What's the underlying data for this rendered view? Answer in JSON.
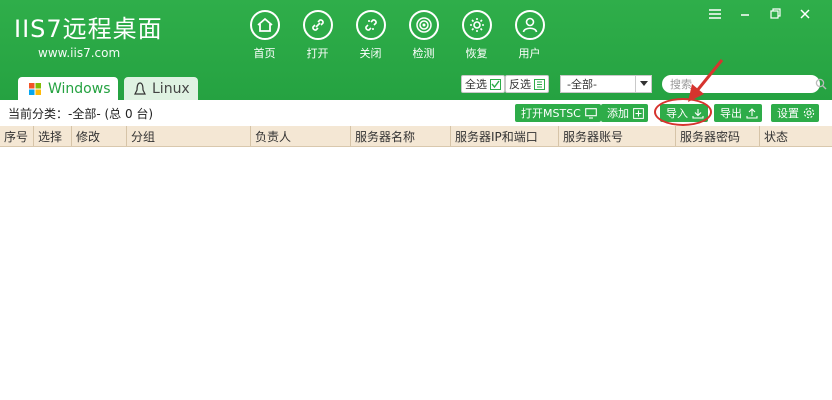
{
  "app": {
    "logo_main": "IIS7远程桌面",
    "logo_sub": "www.iis7.com"
  },
  "nav": [
    {
      "label": "首页",
      "icon": "home-icon"
    },
    {
      "label": "打开",
      "icon": "link-icon"
    },
    {
      "label": "关闭",
      "icon": "unlink-icon"
    },
    {
      "label": "检测",
      "icon": "radar-icon"
    },
    {
      "label": "恢复",
      "icon": "restore-gear-icon"
    },
    {
      "label": "用户",
      "icon": "user-icon"
    }
  ],
  "window_controls": [
    "menu-icon",
    "minimize-icon",
    "restore-icon",
    "close-icon"
  ],
  "tabs": [
    {
      "label": "Windows",
      "icon": "windows-icon",
      "active": true
    },
    {
      "label": "Linux",
      "icon": "linux-icon",
      "active": false
    }
  ],
  "header_controls": {
    "select_all": "全选",
    "invert_select": "反选",
    "category_value": "-全部-",
    "search_placeholder": "搜索"
  },
  "toolbar": {
    "current_category": "当前分类：-全部- (总 0 台)",
    "open_mstsc": "打开MSTSC",
    "add": "添加",
    "import": "导入",
    "export": "导出",
    "settings": "设置"
  },
  "table": {
    "columns": [
      "序号",
      "选择",
      "修改",
      "分组",
      "负责人",
      "服务器名称",
      "服务器IP和端口",
      "服务器账号",
      "服务器密码",
      "状态"
    ],
    "rows": []
  },
  "colors": {
    "brand_green": "#27a443",
    "header_row": "#f4e7d4",
    "highlight_red": "#d6342e"
  }
}
